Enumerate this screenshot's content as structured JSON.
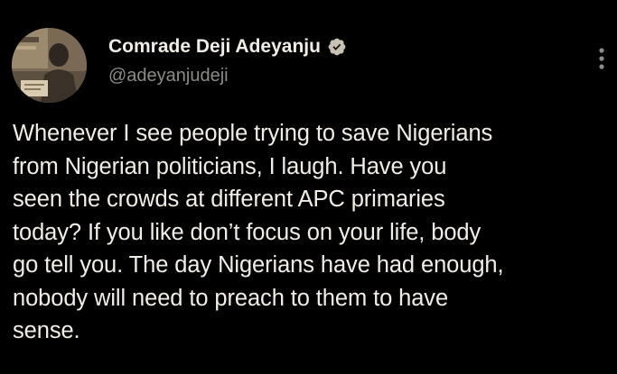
{
  "tweet": {
    "author": {
      "display_name": "Comrade Deji Adeyanju",
      "handle": "@adeyanjudeji",
      "verified": true,
      "verified_icon": "verified-badge-icon",
      "verified_color": "#c9c2b4"
    },
    "more_icon": "more-vertical-icon",
    "text": "Whenever I see people trying to save Nigerians\nfrom Nigerian politicians, I laugh. Have you\nseen the crowds at different APC primaries\ntoday? If you like don’t focus on your life, body\ngo tell you. The day Nigerians have had enough,\nnobody will need to preach to them to have\nsense."
  },
  "theme": {
    "background": "#000000",
    "text_color": "#f2eee6",
    "secondary_text_color": "#8b8b88"
  }
}
